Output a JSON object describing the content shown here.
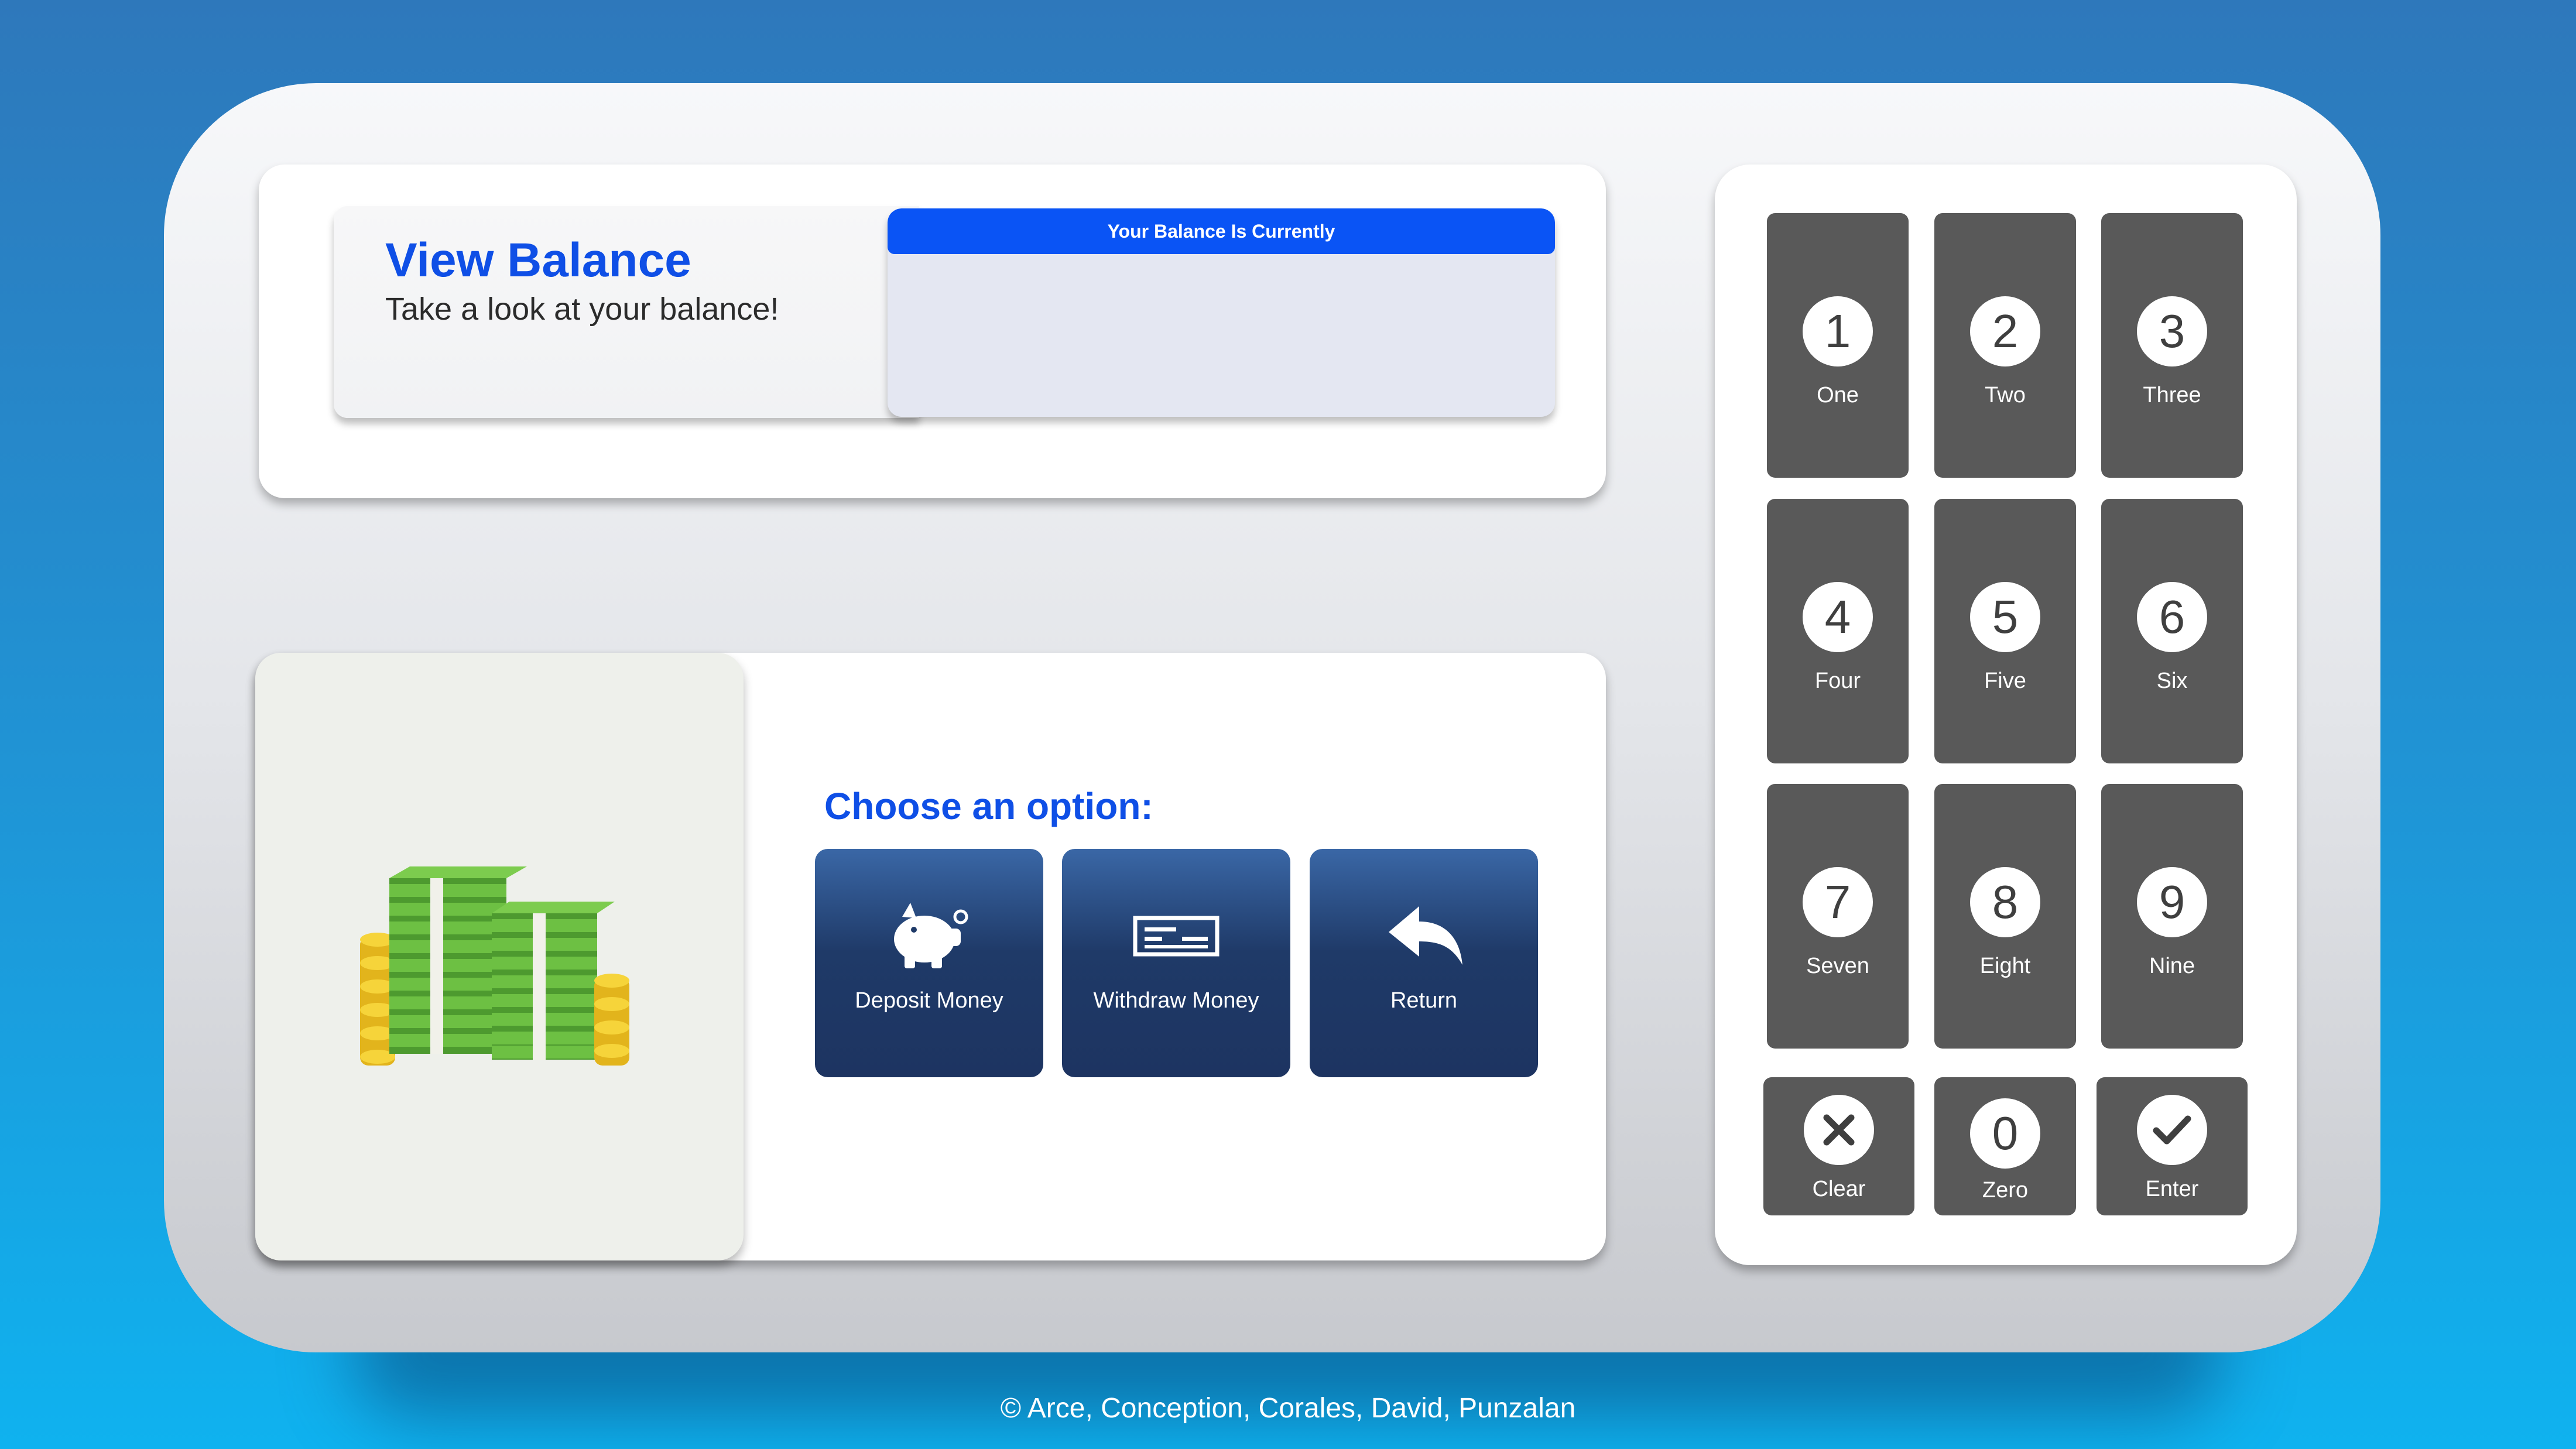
{
  "balance": {
    "title": "View Balance",
    "subtitle": "Take a look at your balance!",
    "display_header": "Your Balance Is Currently",
    "value": ""
  },
  "options": {
    "heading": "Choose an option:",
    "buttons": [
      {
        "label": "Deposit Money",
        "icon": "piggy-bank-icon"
      },
      {
        "label": "Withdraw Money",
        "icon": "check-icon"
      },
      {
        "label": "Return",
        "icon": "return-arrow-icon"
      }
    ]
  },
  "keypad": {
    "keys": [
      {
        "digit": "1",
        "word": "One"
      },
      {
        "digit": "2",
        "word": "Two"
      },
      {
        "digit": "3",
        "word": "Three"
      },
      {
        "digit": "4",
        "word": "Four"
      },
      {
        "digit": "5",
        "word": "Five"
      },
      {
        "digit": "6",
        "word": "Six"
      },
      {
        "digit": "7",
        "word": "Seven"
      },
      {
        "digit": "8",
        "word": "Eight"
      },
      {
        "digit": "9",
        "word": "Nine"
      }
    ],
    "clear_label": "Clear",
    "zero": {
      "digit": "0",
      "word": "Zero"
    },
    "enter_label": "Enter"
  },
  "footer": "© Arce, Conception, Corales, David, Punzalan",
  "colors": {
    "accent_blue": "#0f4fe6",
    "header_blue": "#0a54f5",
    "button_navy": "#1d3461",
    "key_gray": "#595959"
  }
}
